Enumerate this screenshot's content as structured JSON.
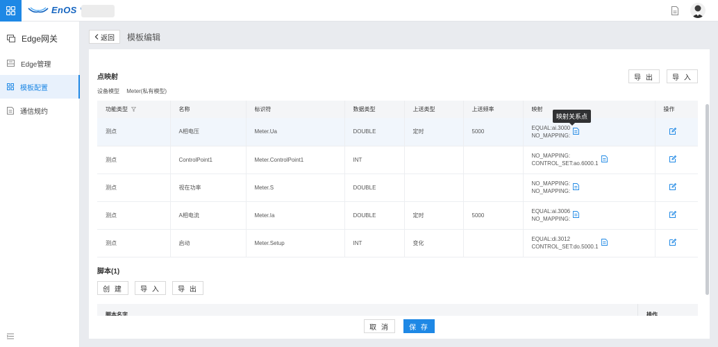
{
  "header": {
    "logo_text": "EnOS",
    "logo_tm": "™",
    "brand_color": "#1e88e5"
  },
  "sidebar": {
    "app_title": "Edge网关",
    "items": [
      {
        "label": "Edge管理",
        "icon": "edge-manage-icon"
      },
      {
        "label": "模板配置",
        "icon": "template-config-icon",
        "active": true
      },
      {
        "label": "通信规约",
        "icon": "protocol-icon"
      }
    ]
  },
  "breadcrumb": {
    "back_label": "返回",
    "title": "模板编辑"
  },
  "point_map": {
    "title": "点映射",
    "device_model_label": "设备模型",
    "device_model_value": "Meter(私有模型)",
    "export_label": "导 出",
    "import_label": "导 入",
    "columns": [
      "功能类型",
      "名称",
      "标识符",
      "数据类型",
      "上送类型",
      "上送频率",
      "映射",
      "操作"
    ],
    "rows": [
      {
        "func": "测点",
        "name": "A相电压",
        "id": "Meter.Ua",
        "dtype": "DOUBLE",
        "send_type": "定时",
        "freq": "5000",
        "map1": "EQUAL:ai.3000",
        "map2": "NO_MAPPING:"
      },
      {
        "func": "测点",
        "name": "ControlPoint1",
        "id": "Meter.ControlPoint1",
        "dtype": "INT",
        "send_type": "",
        "freq": "",
        "map1": "NO_MAPPING:",
        "map2": "CONTROL_SET:ao.6000.1"
      },
      {
        "func": "测点",
        "name": "视在功率",
        "id": "Meter.S",
        "dtype": "DOUBLE",
        "send_type": "",
        "freq": "",
        "map1": "NO_MAPPING:",
        "map2": "NO_MAPPING:"
      },
      {
        "func": "测点",
        "name": "A相电流",
        "id": "Meter.Ia",
        "dtype": "DOUBLE",
        "send_type": "定时",
        "freq": "5000",
        "map1": "EQUAL:ai.3006",
        "map2": "NO_MAPPING:"
      },
      {
        "func": "测点",
        "name": "启动",
        "id": "Meter.Setup",
        "dtype": "INT",
        "send_type": "变化",
        "freq": "",
        "map1": "EQUAL:di.3012",
        "map2": "CONTROL_SET:do.5000.1"
      }
    ],
    "tooltip": "映射关系点"
  },
  "scripts": {
    "title": "脚本(1)",
    "create_label": "创 建",
    "import_label": "导 入",
    "export_label": "导 出",
    "col_name": "脚本名字",
    "col_action": "操作"
  },
  "footer": {
    "cancel_label": "取 消",
    "save_label": "保 存"
  }
}
